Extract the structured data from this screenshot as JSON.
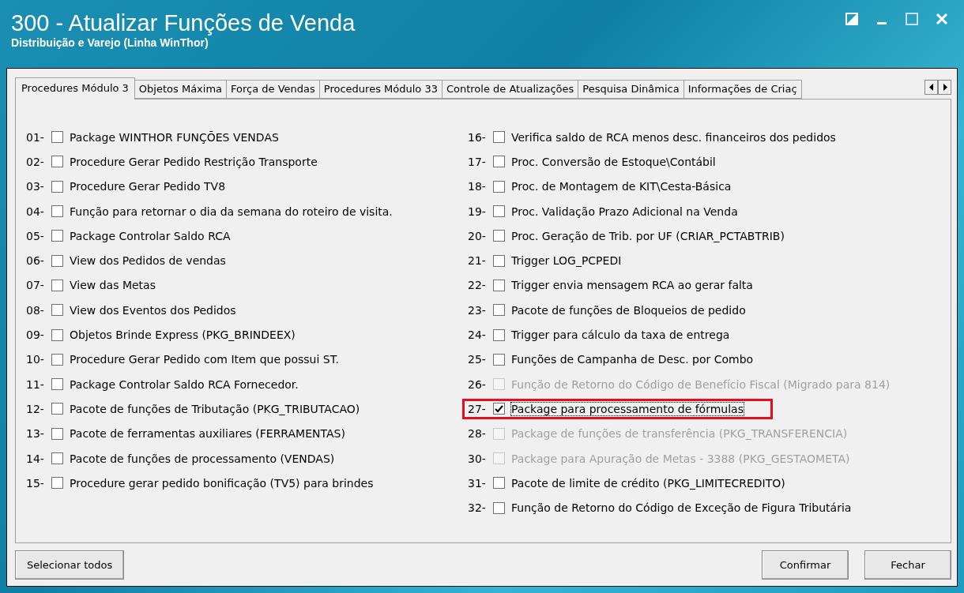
{
  "window": {
    "title": "300 - Atualizar Funções de Venda",
    "subtitle": "Distribuição e Varejo (Linha WinThor)"
  },
  "tabs": [
    {
      "label": "Procedures Módulo 3",
      "selected": true
    },
    {
      "label": "Objetos Máxima",
      "selected": false
    },
    {
      "label": "Força de Vendas",
      "selected": false
    },
    {
      "label": "Procedures Módulo 33",
      "selected": false
    },
    {
      "label": "Controle de Atualizações",
      "selected": false
    },
    {
      "label": "Pesquisa Dinâmica",
      "selected": false
    },
    {
      "label": "Informações de Criaç",
      "selected": false
    }
  ],
  "columns": [
    [
      {
        "number": "01-",
        "label": "Package WINTHOR FUNÇÕES VENDAS",
        "checked": false,
        "disabled": false,
        "highlighted": false
      },
      {
        "number": "02-",
        "label": "Procedure Gerar Pedido Restrição Transporte",
        "checked": false,
        "disabled": false,
        "highlighted": false
      },
      {
        "number": "03-",
        "label": "Procedure Gerar Pedido TV8",
        "checked": false,
        "disabled": false,
        "highlighted": false
      },
      {
        "number": "04-",
        "label": "Função para retornar o dia da semana do roteiro de visita.",
        "checked": false,
        "disabled": false,
        "highlighted": false
      },
      {
        "number": "05-",
        "label": "Package Controlar Saldo RCA",
        "checked": false,
        "disabled": false,
        "highlighted": false
      },
      {
        "number": "06-",
        "label": "View dos Pedidos de vendas",
        "checked": false,
        "disabled": false,
        "highlighted": false
      },
      {
        "number": "07-",
        "label": "View das Metas",
        "checked": false,
        "disabled": false,
        "highlighted": false
      },
      {
        "number": "08-",
        "label": "View dos Eventos dos Pedidos",
        "checked": false,
        "disabled": false,
        "highlighted": false
      },
      {
        "number": "09-",
        "label": "Objetos Brinde Express (PKG_BRINDEEX)",
        "checked": false,
        "disabled": false,
        "highlighted": false
      },
      {
        "number": "10-",
        "label": "Procedure Gerar Pedido com Item que possui ST.",
        "checked": false,
        "disabled": false,
        "highlighted": false
      },
      {
        "number": "11-",
        "label": "Package Controlar Saldo RCA Fornecedor.",
        "checked": false,
        "disabled": false,
        "highlighted": false
      },
      {
        "number": "12-",
        "label": "Pacote de funções de Tributação (PKG_TRIBUTACAO)",
        "checked": false,
        "disabled": false,
        "highlighted": false
      },
      {
        "number": "13-",
        "label": "Pacote de ferramentas auxiliares (FERRAMENTAS)",
        "checked": false,
        "disabled": false,
        "highlighted": false
      },
      {
        "number": "14-",
        "label": "Pacote de funções de processamento (VENDAS)",
        "checked": false,
        "disabled": false,
        "highlighted": false
      },
      {
        "number": "15-",
        "label": "Procedure gerar pedido bonificação (TV5) para brindes",
        "checked": false,
        "disabled": false,
        "highlighted": false
      }
    ],
    [
      {
        "number": "16-",
        "label": "Verifica saldo de RCA menos desc. financeiros dos pedidos",
        "checked": false,
        "disabled": false,
        "highlighted": false
      },
      {
        "number": "17-",
        "label": "Proc. Conversão de Estoque\\Contábil",
        "checked": false,
        "disabled": false,
        "highlighted": false
      },
      {
        "number": "18-",
        "label": "Proc. de Montagem de KIT\\Cesta-Básica",
        "checked": false,
        "disabled": false,
        "highlighted": false
      },
      {
        "number": "19-",
        "label": "Proc. Validação Prazo Adicional na Venda",
        "checked": false,
        "disabled": false,
        "highlighted": false
      },
      {
        "number": "20-",
        "label": "Proc. Geração de Trib. por UF (CRIAR_PCTABTRIB)",
        "checked": false,
        "disabled": false,
        "highlighted": false
      },
      {
        "number": "21-",
        "label": "Trigger LOG_PCPEDI",
        "checked": false,
        "disabled": false,
        "highlighted": false
      },
      {
        "number": "22-",
        "label": "Trigger envia mensagem RCA ao gerar falta",
        "checked": false,
        "disabled": false,
        "highlighted": false
      },
      {
        "number": "23-",
        "label": "Pacote de funções de Bloqueios de pedido",
        "checked": false,
        "disabled": false,
        "highlighted": false
      },
      {
        "number": "24-",
        "label": "Trigger para cálculo da taxa de entrega",
        "checked": false,
        "disabled": false,
        "highlighted": false
      },
      {
        "number": "25-",
        "label": "Funções de Campanha de Desc. por Combo",
        "checked": false,
        "disabled": false,
        "highlighted": false
      },
      {
        "number": "26-",
        "label": "Função de Retorno do Código de Benefício Fiscal (Migrado para 814)",
        "checked": false,
        "disabled": true,
        "highlighted": false
      },
      {
        "number": "27-",
        "label": "Package para processamento de fórmulas",
        "checked": true,
        "disabled": false,
        "highlighted": true
      },
      {
        "number": "28-",
        "label": "Package de funções de transferência (PKG_TRANSFERENCIA)",
        "checked": false,
        "disabled": true,
        "highlighted": false
      },
      {
        "number": "30-",
        "label": "Package para Apuração de Metas - 3388 (PKG_GESTAOMETA)",
        "checked": false,
        "disabled": true,
        "highlighted": false
      },
      {
        "number": "31-",
        "label": "Pacote de limite de crédito (PKG_LIMITECREDITO)",
        "checked": false,
        "disabled": false,
        "highlighted": false
      },
      {
        "number": "32-",
        "label": "Função de Retorno do Código de Exceção de Figura Tributária",
        "checked": false,
        "disabled": false,
        "highlighted": false
      }
    ]
  ],
  "buttons": {
    "left": [
      "Selecionar todos"
    ],
    "right": [
      "Confirmar",
      "Fechar"
    ]
  }
}
